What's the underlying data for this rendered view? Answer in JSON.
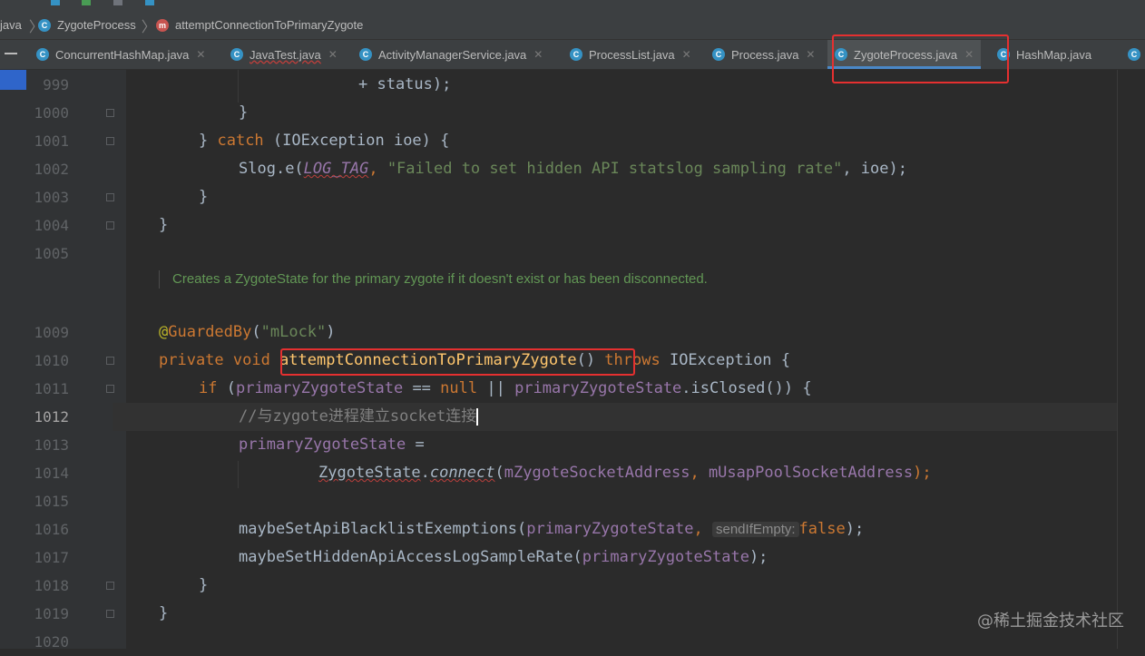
{
  "breadcrumb": {
    "file": "java",
    "class": "ZygoteProcess",
    "method": "attemptConnectionToPrimaryZygote"
  },
  "tabs": [
    {
      "label": "ConcurrentHashMap.java"
    },
    {
      "label": "JavaTest.java"
    },
    {
      "label": "ActivityManagerService.java"
    },
    {
      "label": "ProcessList.java"
    },
    {
      "label": "Process.java"
    },
    {
      "label": "ZygoteProcess.java",
      "active": true
    },
    {
      "label": "HashMap.java"
    }
  ],
  "line_numbers": [
    "999",
    "1000",
    "1001",
    "1002",
    "1003",
    "1004",
    "1005",
    "1009",
    "1010",
    "1011",
    "1012",
    "1013",
    "1014",
    "1015",
    "1016",
    "1017",
    "1018",
    "1019",
    "1020"
  ],
  "current_line": "1012",
  "code": {
    "l999_text": "+ status);",
    "l1000": "}",
    "l1001_close": "} ",
    "l1001_catch": "catch",
    "l1001_rest": " (IOException ioe) {",
    "l1002_slog": "Slog.",
    "l1002_e": "e(",
    "l1002_tag": "LOG_TAG",
    "l1002_comma": ", ",
    "l1002_str": "\"Failed to set hidden API statslog sampling rate\"",
    "l1002_end": ", ioe);",
    "l1003": "}",
    "l1004": "}",
    "javadoc": "Creates a ZygoteState for the primary zygote if it doesn't exist or has been disconnected.",
    "l1009_at": "@",
    "l1009_ann": "GuardedBy",
    "l1009_p1": "(",
    "l1009_str": "\"mLock\"",
    "l1009_p2": ")",
    "l1010_mod": "private void ",
    "l1010_name": "attemptConnectionToPrimaryZygote",
    "l1010_parens": "()",
    "l1010_throws": " throws ",
    "l1010_rest": "IOException {",
    "l1011_if": "if",
    "l1011_p": " (",
    "l1011_f1": "primaryZygoteState",
    "l1011_eq": " == ",
    "l1011_null": "null",
    "l1011_or": " || ",
    "l1011_f2": "primaryZygoteState",
    "l1011_end": ".isClosed()) {",
    "l1012_comment": "//与zygote进程建立socket连接",
    "l1013_field": "primaryZygoteState",
    "l1013_eq": " =",
    "l1014_cls": "ZygoteState",
    "l1014_dot": ".",
    "l1014_m": "connect",
    "l1014_p": "(",
    "l1014_a1": "mZygoteSocketAddress",
    "l1014_c": ", ",
    "l1014_a2": "mUsapPoolSocketAddress",
    "l1014_end": ");",
    "l1016_call": "maybeSetApiBlacklistExemptions(",
    "l1016_field": "primaryZygoteState",
    "l1016_c": ", ",
    "l1016_hint": "sendIfEmpty:",
    "l1016_false": "false",
    "l1016_end": ");",
    "l1017_call": "maybeSetHiddenApiAccessLogSampleRate(",
    "l1017_field": "primaryZygoteState",
    "l1017_end": ");",
    "l1018": "}",
    "l1019": "}"
  },
  "watermark": "@稀土掘金技术社区",
  "colors": {
    "background": "#2b2b2b",
    "keyword": "#cc7832",
    "string": "#6a8759",
    "field": "#9876aa",
    "method_decl": "#ffc66d",
    "annotation_box": "#e53030"
  }
}
